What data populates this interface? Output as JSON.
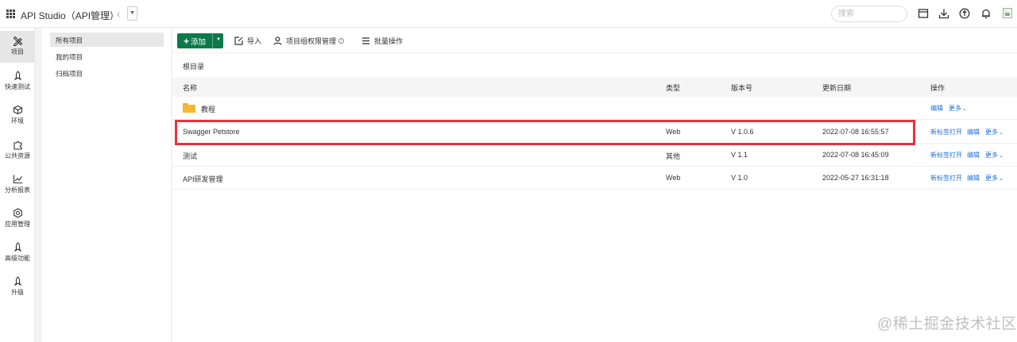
{
  "app": {
    "title": "API Studio（API管理）"
  },
  "header": {
    "search_placeholder": "搜索"
  },
  "top_icons": [
    "window-icon",
    "download-icon",
    "upload-circle-icon",
    "bell-icon",
    "broken-image-icon"
  ],
  "rail": [
    {
      "label": "项目",
      "icon": "pen-ruler-icon",
      "active": true
    },
    {
      "label": "快速测试",
      "icon": "rocket-icon"
    },
    {
      "label": "环境",
      "icon": "cube-icon"
    },
    {
      "label": "公共资源",
      "icon": "puzzle-icon"
    },
    {
      "label": "分析报表",
      "icon": "line-chart-icon"
    },
    {
      "label": "应用管理",
      "icon": "hexagon-gear-icon"
    },
    {
      "label": "高级功能",
      "icon": "rocket-icon"
    },
    {
      "label": "升级",
      "icon": "rocket-icon"
    }
  ],
  "subnav": [
    {
      "label": "所有项目",
      "active": true
    },
    {
      "label": "我的项目"
    },
    {
      "label": "归档项目"
    }
  ],
  "toolbar": {
    "add_label": "添加",
    "import_label": "导入",
    "permission_label": "项目组权限管理",
    "batch_label": "批量操作"
  },
  "breadcrumb": "根目录",
  "table": {
    "columns": {
      "name": "名称",
      "type": "类型",
      "version": "版本号",
      "updated": "更新日期",
      "actions": "操作"
    },
    "rows": [
      {
        "name": "教程",
        "type": "",
        "version": "",
        "updated": "",
        "is_folder": true,
        "actions": [
          "编辑",
          "更多"
        ]
      },
      {
        "name": "Swagger Petstore",
        "type": "Web",
        "version": "V 1.0.6",
        "updated": "2022-07-08 16:55:57",
        "actions": [
          "新标签打开",
          "编辑",
          "更多"
        ],
        "highlighted": true
      },
      {
        "name": "测试",
        "type": "其他",
        "version": "V 1.1",
        "updated": "2022-07-08 16:45:09",
        "actions": [
          "新标签打开",
          "编辑",
          "更多"
        ]
      },
      {
        "name": "API研发管理",
        "type": "Web",
        "version": "V 1.0",
        "updated": "2022-05-27 16:31:18",
        "actions": [
          "新标签打开",
          "编辑",
          "更多"
        ]
      }
    ]
  },
  "colors": {
    "primary_green": "#0b7a48",
    "link_blue": "#1e6fd9",
    "highlight_red": "#e8333b",
    "folder_yellow": "#f5b82e"
  },
  "watermark": "@稀土掘金技术社区"
}
